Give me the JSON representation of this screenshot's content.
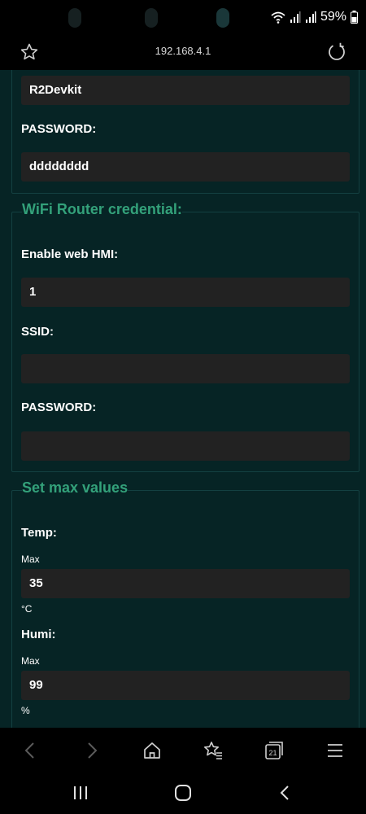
{
  "status_bar": {
    "battery_percent": "59%"
  },
  "browser": {
    "url": "192.168.4.1"
  },
  "ap_section": {
    "ssid_value": "R2Devkit",
    "password_label": "PASSWORD:",
    "password_value": "dddddddd"
  },
  "router_section": {
    "legend": "WiFi Router credential:",
    "enable_label": "Enable web HMI:",
    "enable_value": "1",
    "ssid_label": "SSID:",
    "ssid_value": "",
    "password_label": "PASSWORD:",
    "password_value": ""
  },
  "max_section": {
    "legend": "Set max values",
    "temp_label": "Temp:",
    "temp_max_label": "Max",
    "temp_value": "35",
    "temp_unit": "°C",
    "humi_label": "Humi:",
    "humi_max_label": "Max",
    "humi_value": "99",
    "humi_unit": "%"
  },
  "colors": {
    "background": "#062425",
    "accent": "#33a17a",
    "input_bg": "#222222"
  },
  "icons": [
    "star-icon",
    "reload-icon",
    "back-icon",
    "forward-icon",
    "home-icon",
    "bookmarks-icon",
    "tabs-icon",
    "menu-icon"
  ]
}
